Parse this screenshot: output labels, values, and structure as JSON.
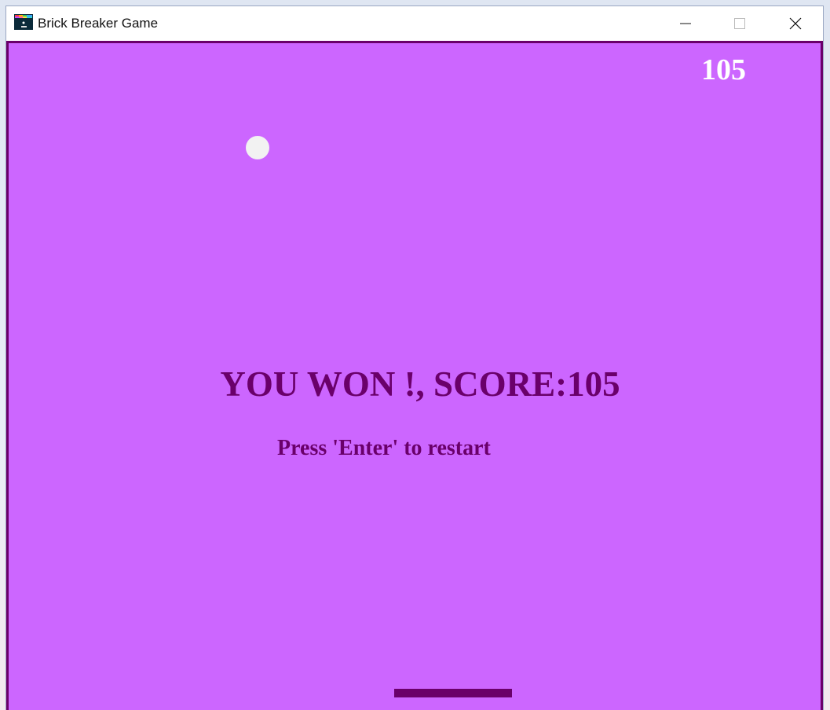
{
  "window": {
    "title": "Brick Breaker Game",
    "icon": "brick-breaker-app-icon",
    "controls": [
      "minimize-icon",
      "maximize-icon",
      "close-icon"
    ]
  },
  "game": {
    "score": "105",
    "win_message": "YOU WON !, SCORE:105",
    "restart_message": "Press 'Enter' to restart",
    "colors": {
      "background": "#cc66ff",
      "border": "#6a006a",
      "text": "#6a006a",
      "score": "#ffffff",
      "ball": "#f2f2f2",
      "paddle": "#6a006a"
    }
  }
}
